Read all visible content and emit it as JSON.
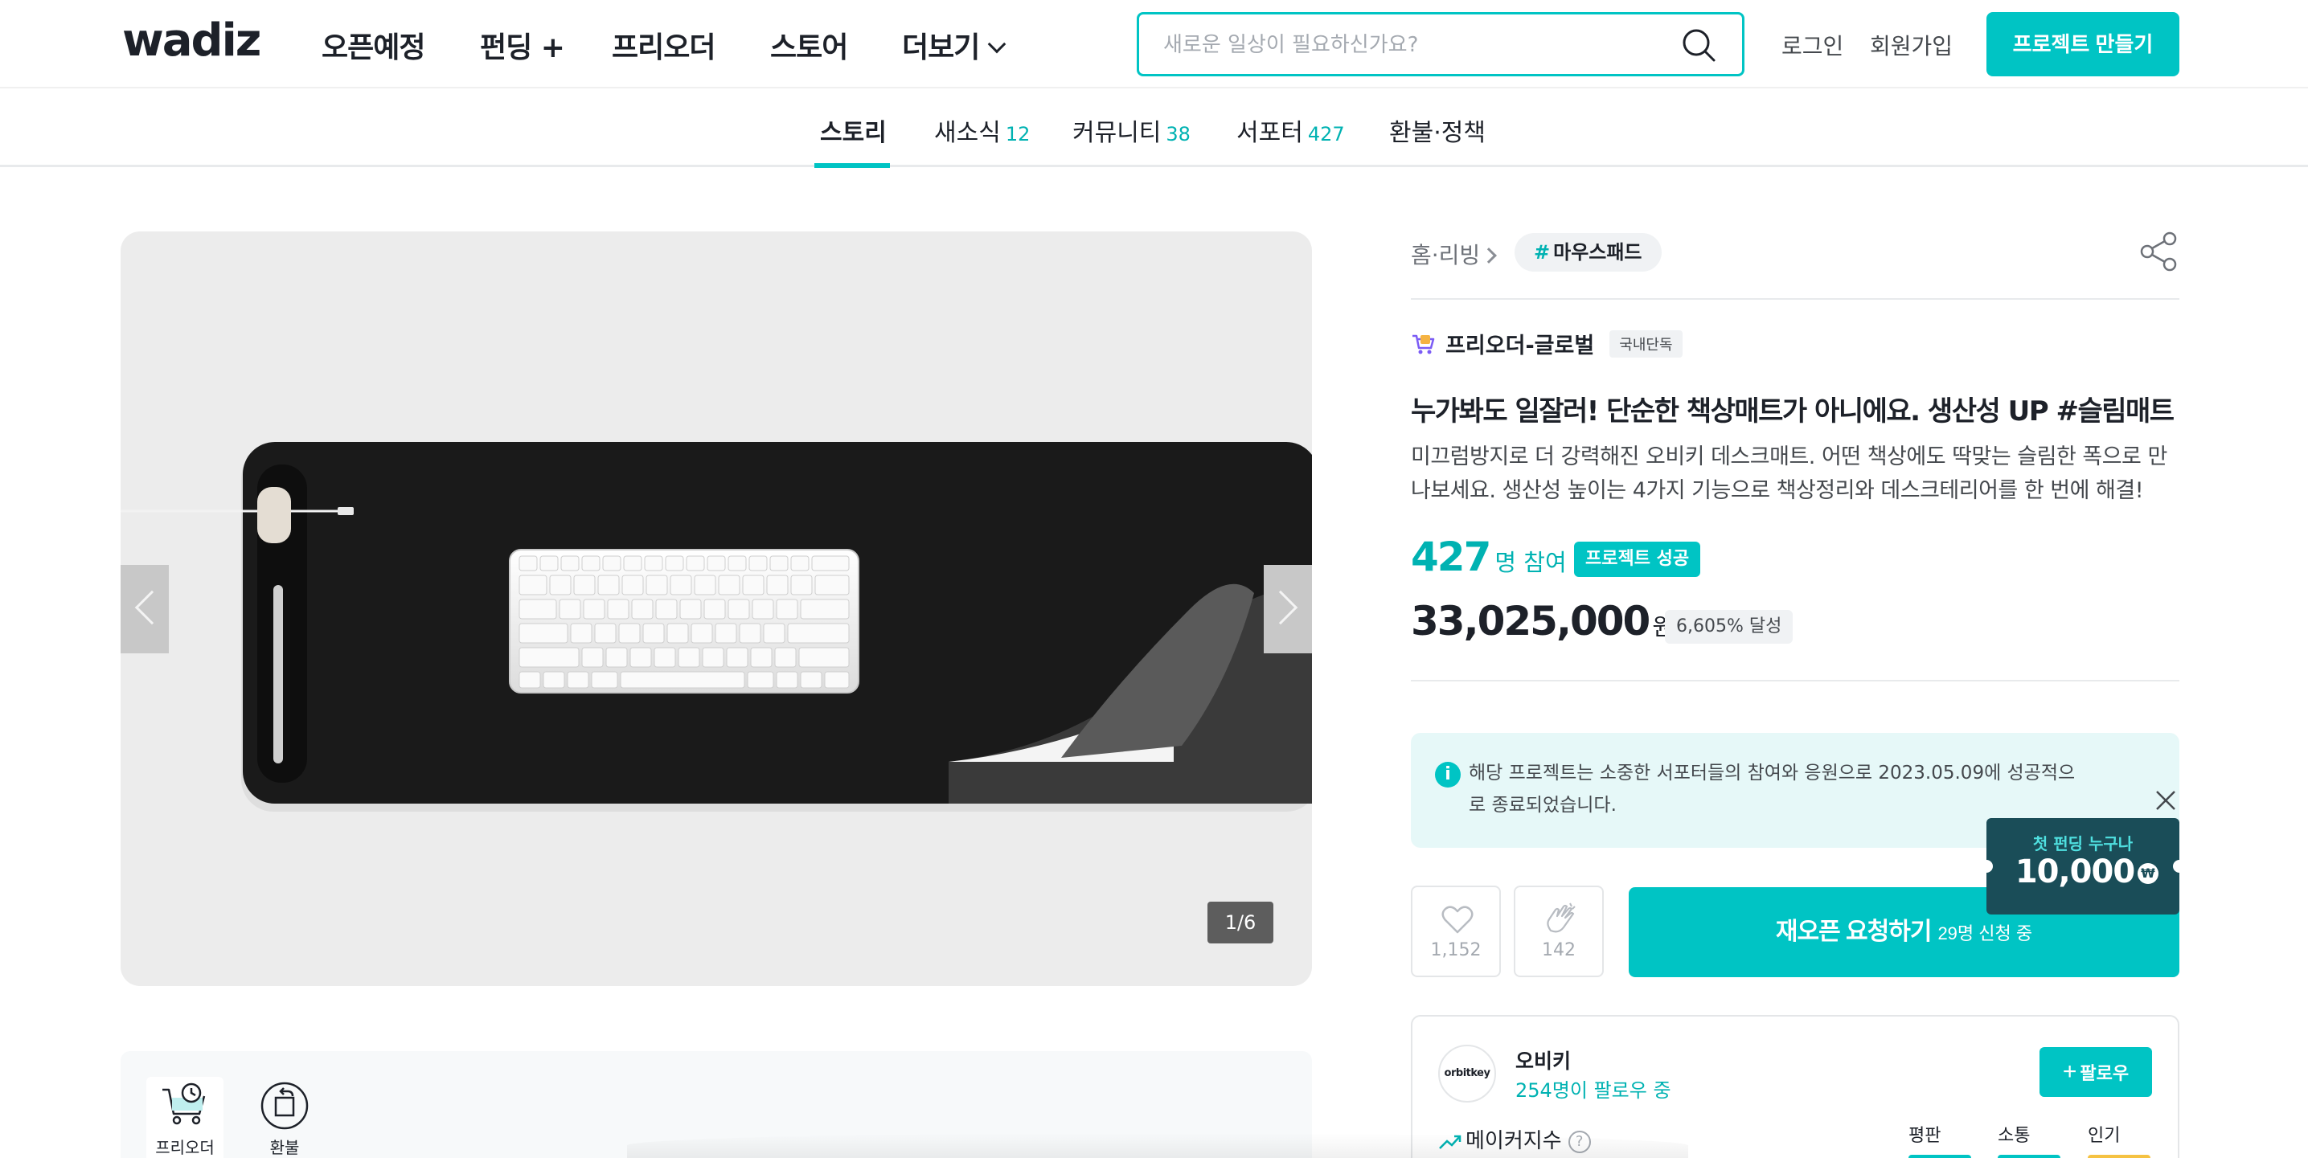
{
  "header": {
    "logo": "wadiz",
    "nav": [
      "오픈예정",
      "펀딩 +",
      "프리오더",
      "스토어",
      "더보기"
    ],
    "search_placeholder": "새로운 일상이 필요하신가요?",
    "login": "로그인",
    "signup": "회원가입",
    "make_project": "프로젝트 만들기",
    "accent_color": "#00c4c4"
  },
  "tabs": [
    {
      "label": "스토리",
      "count": ""
    },
    {
      "label": "새소식",
      "count": "12"
    },
    {
      "label": "커뮤니티",
      "count": "38"
    },
    {
      "label": "서포터",
      "count": "427"
    },
    {
      "label": "환불·정책",
      "count": ""
    }
  ],
  "gallery": {
    "pager": "1/6"
  },
  "project": {
    "breadcrumb": "홈·리빙",
    "tag": "마우스패드",
    "tag_hash": "#",
    "category": "프리오더-글로벌",
    "category_badge": "국내단독",
    "title": "누가봐도 일잘러! 단순한 책상매트가 아니에요. 생산성 UP #슬림매트",
    "description": "미끄럼방지로 더 강력해진 오비키 데스크매트. 어떤 책상에도 딱맞는 슬림한 폭으로 만나보세요. 생산성 높이는 4가지 기능으로 책상정리와 데스크테리어를 한 번에 해결!",
    "supporters_num": "427",
    "supporters_unit": "명 참여",
    "status_badge": "프로젝트 성공",
    "amount_num": "33,025,000",
    "amount_unit": "원",
    "rate_badge": "6,605% 달성"
  },
  "notice": {
    "icon": "i",
    "text": "해당 프로젝트는 소중한 서포터들의 참여와 응원으로 2023.05.09에 성공적으로 종료되었습니다."
  },
  "coupon": {
    "top": "첫 펀딩 누구나",
    "amount": "10,000",
    "won": "₩"
  },
  "actions": {
    "like_count": "1,152",
    "cheer_count": "142",
    "reopen_label": "재오픈 요청하기",
    "reopen_sub": "29명 신청 중"
  },
  "maker": {
    "avatar_text": "orbitkey",
    "name": "오비키",
    "followers": "254명이 팔로우 중",
    "follow_button": "팔로우",
    "index_label": "메이커지수",
    "index_help": "?",
    "metrics": [
      {
        "label": "평판",
        "color": "#00c4c4"
      },
      {
        "label": "소통",
        "color": "#00c4c4"
      },
      {
        "label": "인기",
        "color": "#f5c242"
      }
    ]
  },
  "story_nav": [
    {
      "label": "프리오더",
      "icon": "cart-clock-icon"
    },
    {
      "label": "환불",
      "icon": "refund-box-icon"
    }
  ]
}
